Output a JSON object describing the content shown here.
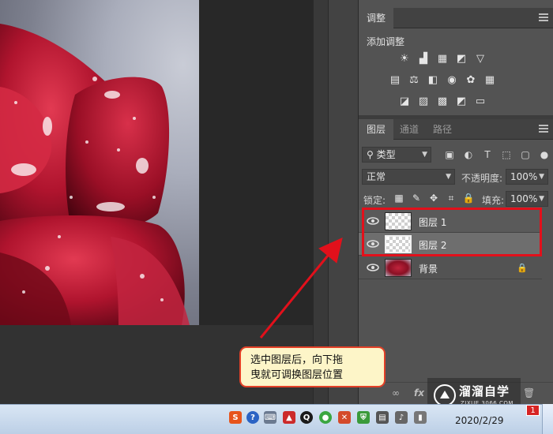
{
  "adjustments_panel": {
    "tab": "调整",
    "title": "添加调整",
    "rows": [
      [
        "brightness-icon",
        "levels-icon",
        "curves-icon",
        "exposure-icon",
        "vibrance-icon"
      ],
      [
        "hue-saturation-icon",
        "color-balance-icon",
        "black-white-icon",
        "photo-filter-icon",
        "channel-mixer-icon",
        "color-lookup-icon"
      ],
      [
        "invert-icon",
        "posterize-icon",
        "threshold-icon",
        "selective-color-icon",
        "gradient-map-icon"
      ]
    ]
  },
  "layers_panel": {
    "tabs": [
      "图层",
      "通道",
      "路径"
    ],
    "filter_kind": "类型",
    "blend_mode": "正常",
    "opacity_label": "不透明度:",
    "opacity_value": "100%",
    "lock_label": "锁定:",
    "fill_label": "填充:",
    "fill_value": "100%",
    "layers": [
      {
        "name": "图层 1",
        "visible": true,
        "thumbnail": "transparent",
        "highlighted": true
      },
      {
        "name": "图层 2",
        "visible": true,
        "thumbnail": "transparent",
        "highlighted": true,
        "selected": true
      },
      {
        "name": "背景",
        "visible": true,
        "thumbnail": "rose",
        "locked": true
      }
    ]
  },
  "callout": {
    "line1": "选中图层后，向下拖",
    "line2": "曳就可调换图层位置"
  },
  "watermark": {
    "text": "溜溜自学",
    "sub": "ZIXUE.3066.COM"
  },
  "taskbar": {
    "date": "2020/2/29",
    "notification_count": "1"
  },
  "colors": {
    "highlight": "#e2101b",
    "callout_bg": "#fdf5c8",
    "callout_border": "#e34027"
  }
}
